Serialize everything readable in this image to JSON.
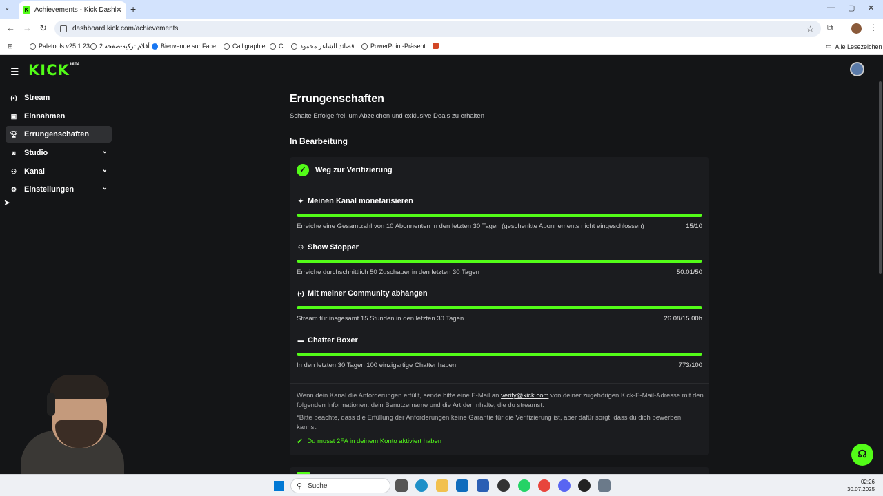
{
  "browser": {
    "tab_title": "Achievements - Kick Dashboard",
    "tab_favicon": "K",
    "url": "dashboard.kick.com/achievements",
    "bookmarks": [
      "Paletools v25.1.23",
      "أفلام تركية-صفحة 2",
      "Bienvenue sur Face...",
      "Calligraphie",
      "C",
      "قصائد للشاعر محمود...",
      "PowerPoint-Präsent..."
    ],
    "all_bookmarks": "Alle Lesezeichen"
  },
  "app": {
    "logo": "KICK",
    "logo_beta": "BETA",
    "accent_color": "#53fc18",
    "sidebar": {
      "items": [
        {
          "label": "Stream",
          "icon": "broadcast-icon"
        },
        {
          "label": "Einnahmen",
          "icon": "earnings-icon"
        },
        {
          "label": "Errungenschaften",
          "icon": "trophy-icon"
        },
        {
          "label": "Studio",
          "icon": "studio-icon"
        },
        {
          "label": "Kanal",
          "icon": "channel-icon"
        },
        {
          "label": "Einstellungen",
          "icon": "gear-icon"
        }
      ]
    },
    "main": {
      "title": "Errungenschaften",
      "subtitle": "Schalte Erfolge frei, um Abzeichen und exklusive Deals zu erhalten",
      "section": "In Bearbeitung",
      "card": {
        "title": "Weg zur Verifizierung",
        "achievements": [
          {
            "name": "Meinen Kanal monetarisieren",
            "icon": "sparkle-icon",
            "desc": "Erreiche eine Gesamtzahl von 10 Abonnenten in den letzten 30 Tagen (geschenkte Abonnements nicht eingeschlossen)",
            "value": "15/10",
            "progress": 1.0
          },
          {
            "name": "Show Stopper",
            "icon": "users-icon",
            "desc": "Erreiche durchschnittlich 50 Zuschauer in den letzten 30 Tagen",
            "value": "50.01/50",
            "progress": 1.0
          },
          {
            "name": "Mit meiner Community abhängen",
            "icon": "broadcast-icon",
            "desc": "Stream für insgesamt 15 Stunden in den letzten 30 Tagen",
            "value": "26.08/15.00h",
            "progress": 1.0
          },
          {
            "name": "Chatter Boxer",
            "icon": "chat-icon",
            "desc": "In den letzten 30 Tagen 100 einzigartige Chatter haben",
            "value": "773/100",
            "progress": 1.0
          }
        ],
        "info_before": "Wenn dein Kanal die Anforderungen erfüllt, sende bitte eine E-Mail an",
        "info_email": "verify@kick.com",
        "info_after": "von deiner zugehörigen Kick-E-Mail-Adresse mit den folgenden Informationen: dein Benutzername und die Art der Inhalte, die du streamst.",
        "info_note": "*Bitte beachte, dass die Erfüllung der Anforderungen keine Garantie für die Verifizierung ist, aber dafür sorgt, dass du dich bewerben kannst.",
        "requirement": "Du musst 2FA in deinem Konto aktiviert haben"
      }
    }
  },
  "taskbar": {
    "search_placeholder": "Suche",
    "time": "02:26",
    "date": "30.07.2025"
  }
}
